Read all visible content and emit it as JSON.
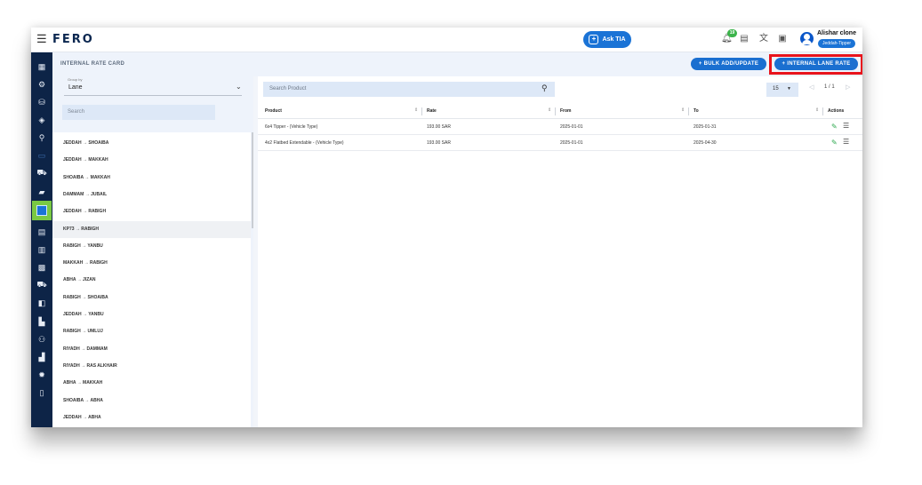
{
  "header": {
    "logo": "FERO",
    "ask_label": "Ask TIA",
    "notification_count": "19",
    "user_name": "Alishar clone",
    "user_role": "Jeddah-Tipper"
  },
  "subheader": {
    "title": "INTERNAL RATE CARD",
    "bulk_label": "+  BULK ADD/UPDATE",
    "lane_label": "+  INTERNAL LANE RATE"
  },
  "group_by": {
    "label": "Group by",
    "value": "Lane"
  },
  "lane_search": {
    "placeholder": "Search"
  },
  "lanes": [
    "JEDDAH → SHOAIBA",
    "JEDDAH → MAKKAH",
    "SHOAIBA → MAKKAH",
    "DAMMAM → JUBAIL",
    "JEDDAH → RABIGH",
    "KP73 → RABIGH",
    "RABIGH → YANBU",
    "MAKKAH → RABIGH",
    "ABHA → JIZAN",
    "RABIGH → SHOAIBA",
    "JEDDAH → YANBU",
    "RABIGH → UMLUJ",
    "RIYADH → DAMMAM",
    "RIYADH → RAS ALKHAIR",
    "ABHA → MAKKAH",
    "SHOAIBA → ABHA",
    "JEDDAH → ABHA"
  ],
  "selected_lane_index": 5,
  "table": {
    "search_placeholder": "Search Product",
    "page_size": "15",
    "page_info": "1 / 1",
    "columns": [
      "Product",
      "Rate",
      "From",
      "To",
      "Actions"
    ],
    "rows": [
      [
        "6x4 Tipper - (Vehicle Type)",
        "193.00 SAR",
        "2025-01-01",
        "2025-01-31"
      ],
      [
        "4x2 Flatbed Extendable - (Vehicle Type)",
        "193.00 SAR",
        "2025-01-01",
        "2025-04-30"
      ]
    ]
  },
  "colors": {
    "nav_bg": "#0d2447",
    "accent": "#1a6fd0",
    "highlight": "#e8141c",
    "active_nav": "#7ac943"
  }
}
